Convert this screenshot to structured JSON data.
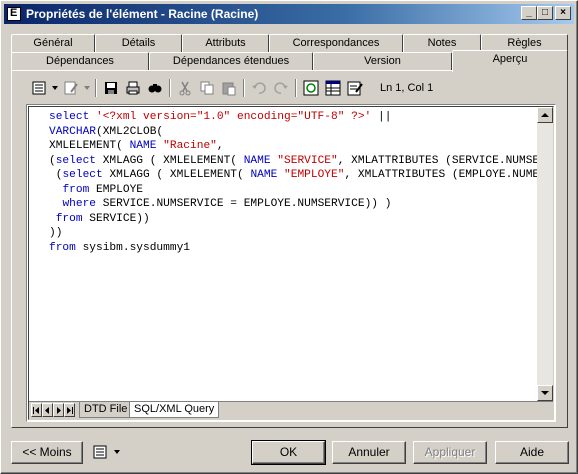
{
  "window": {
    "title": "Propriétés de l'élément - Racine (Racine)",
    "controls": {
      "minimize": "_",
      "maximize": "□",
      "close": "×"
    }
  },
  "tabs_row1": [
    "Général",
    "Détails",
    "Attributs",
    "Correspondances",
    "Notes",
    "Règles"
  ],
  "tabs_row2": [
    "Dépendances",
    "Dépendances étendues",
    "Version",
    "Aperçu"
  ],
  "active_tab": "Aperçu",
  "toolbar": {
    "icons": [
      "properties-icon",
      "dropdown-arrow-icon",
      "edit-icon",
      "dropdown-arrow-icon",
      "save-icon",
      "print-icon",
      "find-icon",
      "cut-icon",
      "copy-icon",
      "paste-icon",
      "undo-icon",
      "redo-icon",
      "refresh-icon",
      "grid-icon",
      "edit-properties-icon"
    ],
    "position": "Ln 1, Col 1"
  },
  "code_lines": [
    [
      {
        "t": "select ",
        "c": "kw"
      },
      {
        "t": "'<?xml version=\"1.0\" encoding=\"UTF-8\" ?>'",
        "c": "str"
      },
      {
        "t": " ||",
        "c": ""
      }
    ],
    [
      {
        "t": "VARCHAR",
        "c": "kw"
      },
      {
        "t": "(XML2CLOB(",
        "c": ""
      }
    ],
    [
      {
        "t": "XMLELEMENT( ",
        "c": ""
      },
      {
        "t": "NAME ",
        "c": "kw"
      },
      {
        "t": "\"Racine\"",
        "c": "str"
      },
      {
        "t": ",",
        "c": ""
      }
    ],
    [
      {
        "t": "(",
        "c": ""
      },
      {
        "t": "select ",
        "c": "kw"
      },
      {
        "t": "XMLAGG ( XMLELEMENT( ",
        "c": ""
      },
      {
        "t": "NAME ",
        "c": "kw"
      },
      {
        "t": "\"SERVICE\"",
        "c": "str"
      },
      {
        "t": ", XMLATTRIBUTES (SERVICE.NUMSERVICE,",
        "c": ""
      }
    ],
    [
      {
        "t": " (",
        "c": ""
      },
      {
        "t": "select ",
        "c": "kw"
      },
      {
        "t": "XMLAGG ( XMLELEMENT( ",
        "c": ""
      },
      {
        "t": "NAME ",
        "c": "kw"
      },
      {
        "t": "\"EMPLOYE\"",
        "c": "str"
      },
      {
        "t": ", XMLATTRIBUTES (EMPLOYE.NUMEMPLOYE,",
        "c": ""
      }
    ],
    [
      {
        "t": "  ",
        "c": ""
      },
      {
        "t": "from ",
        "c": "kw"
      },
      {
        "t": "EMPLOYE",
        "c": ""
      }
    ],
    [
      {
        "t": "  ",
        "c": ""
      },
      {
        "t": "where ",
        "c": "kw"
      },
      {
        "t": "SERVICE.NUMSERVICE = EMPLOYE.NUMSERVICE)) )",
        "c": ""
      }
    ],
    [
      {
        "t": " ",
        "c": ""
      },
      {
        "t": "from ",
        "c": "kw"
      },
      {
        "t": "SERVICE))",
        "c": ""
      }
    ],
    [
      {
        "t": "))",
        "c": ""
      }
    ],
    [
      {
        "t": "from ",
        "c": "kw"
      },
      {
        "t": "sysibm.sysdummy1",
        "c": ""
      }
    ]
  ],
  "sub_tabs": [
    "DTD File",
    "SQL/XML Query"
  ],
  "active_sub_tab": "SQL/XML Query",
  "buttons": {
    "less": "<< Moins",
    "ok": "OK",
    "cancel": "Annuler",
    "apply": "Appliquer",
    "help": "Aide"
  },
  "colors": {
    "keyword": "#0000c0",
    "string": "#c00000",
    "title_bar": "#0a246a"
  }
}
